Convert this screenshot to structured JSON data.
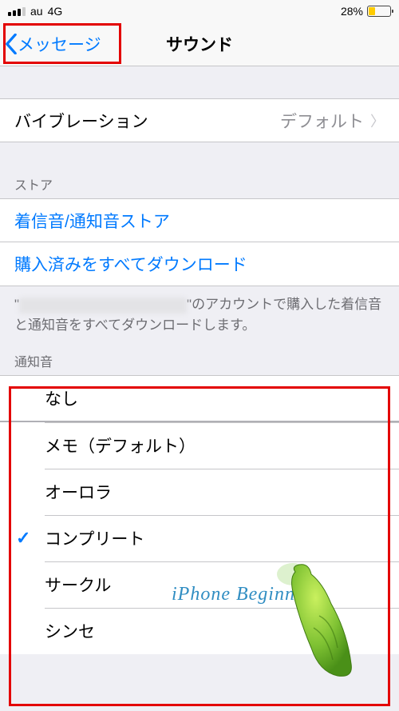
{
  "status": {
    "carrier": "au",
    "network": "4G",
    "battery_pct": "28%"
  },
  "nav": {
    "back_label": "メッセージ",
    "title": "サウンド"
  },
  "vibration": {
    "label": "バイブレーション",
    "value": "デフォルト"
  },
  "store": {
    "header": "ストア",
    "tone_store": "着信音/通知音ストア",
    "download_all": "購入済みをすべてダウンロード",
    "footer_suffix": "のアカウントで購入した着信音と通知音をすべてダウンロードします。"
  },
  "alert_tones": {
    "header": "通知音",
    "items": [
      {
        "label": "なし",
        "checked": false
      },
      {
        "label": "メモ（デフォルト）",
        "checked": false
      },
      {
        "label": "オーロラ",
        "checked": false
      },
      {
        "label": "コンプリート",
        "checked": true
      },
      {
        "label": "サークル",
        "checked": false
      },
      {
        "label": "シンセ",
        "checked": false
      }
    ]
  },
  "watermark": "iPhone Beginners"
}
